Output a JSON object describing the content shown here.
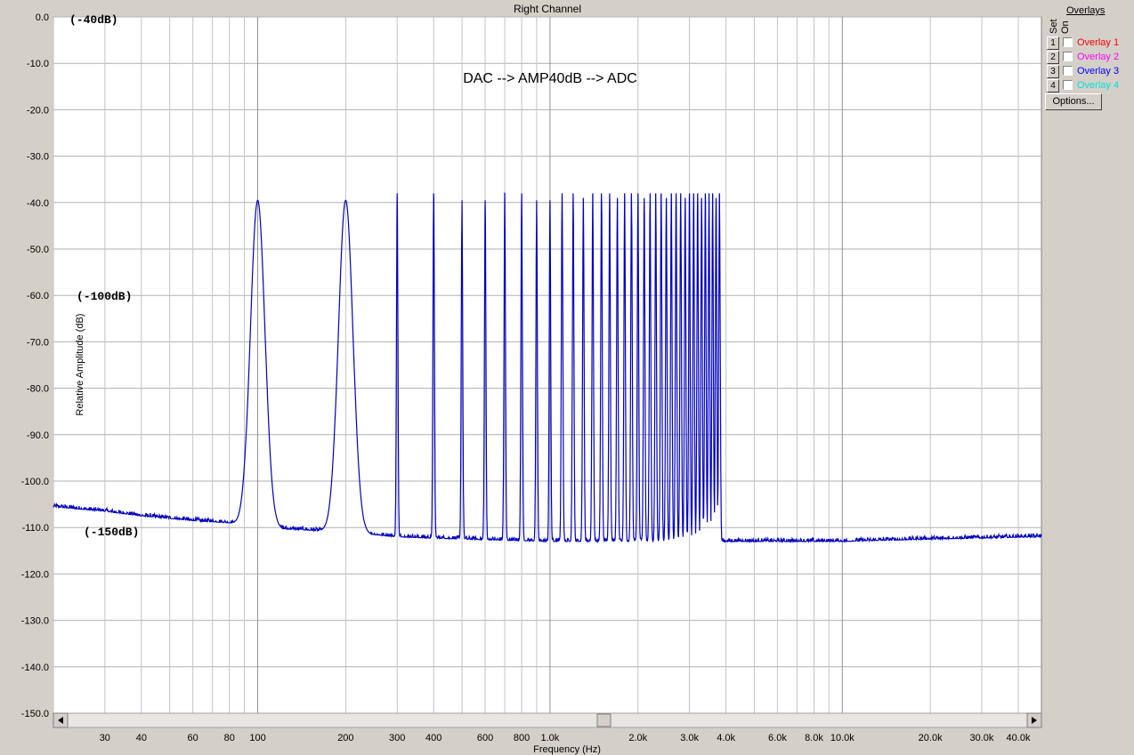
{
  "chart_data": {
    "type": "line",
    "title": "Right Channel",
    "xlabel": "Frequency (Hz)",
    "ylabel": "Relative Amplitude (dB)",
    "x_scale": "log",
    "xlim": [
      20,
      48000
    ],
    "ylim": [
      -150,
      0
    ],
    "yticks": [
      "0.0",
      "-10.0",
      "-20.0",
      "-30.0",
      "-40.0",
      "-50.0",
      "-60.0",
      "-70.0",
      "-80.0",
      "-90.0",
      "-100.0",
      "-110.0",
      "-120.0",
      "-130.0",
      "-140.0",
      "-150.0"
    ],
    "ytick_values": [
      0,
      -10,
      -20,
      -30,
      -40,
      -50,
      -60,
      -70,
      -80,
      -90,
      -100,
      -110,
      -120,
      -130,
      -140,
      -150
    ],
    "xticks": [
      "30",
      "40",
      "60",
      "80",
      "100",
      "200",
      "300",
      "400",
      "600",
      "800",
      "1.0k",
      "2.0k",
      "3.0k",
      "4.0k",
      "6.0k",
      "8.0k",
      "10.0k",
      "20.0k",
      "30.0k",
      "40.0k"
    ],
    "xtick_values": [
      30,
      40,
      60,
      80,
      100,
      200,
      300,
      400,
      600,
      800,
      1000,
      2000,
      3000,
      4000,
      6000,
      8000,
      10000,
      20000,
      30000,
      40000
    ],
    "annotation": "DAC --> AMP40dB --> ADC",
    "right_axis_labels": [
      "(-40dB)",
      "(-100dB)",
      "(-150dB)"
    ],
    "right_axis_values": [
      0,
      -60,
      -110
    ],
    "grid": true,
    "series": [
      {
        "color": "#0000c0",
        "noise_floor": [
          [
            20,
            -105.5
          ],
          [
            30,
            -106.5
          ],
          [
            40,
            -107.5
          ],
          [
            60,
            -108.5
          ],
          [
            80,
            -109
          ],
          [
            100,
            -110
          ],
          [
            200,
            -111
          ],
          [
            300,
            -112
          ],
          [
            500,
            -112.5
          ],
          [
            1000,
            -113
          ],
          [
            4000,
            -113
          ],
          [
            6000,
            -113
          ],
          [
            10000,
            -113
          ],
          [
            20000,
            -112.5
          ],
          [
            48000,
            -112
          ]
        ],
        "peaks": [
          {
            "freq": 100,
            "level": -39.5
          },
          {
            "freq": 200,
            "level": -39.5
          },
          {
            "freq": 300,
            "level": -38
          },
          {
            "freq": 400,
            "level": -38
          },
          {
            "freq": 500,
            "level": -39.5
          },
          {
            "freq": 600,
            "level": -39.5
          },
          {
            "freq": 700,
            "level": -38
          },
          {
            "freq": 800,
            "level": -38
          },
          {
            "freq": 900,
            "level": -39.5
          },
          {
            "freq": 1000,
            "level": -39.5
          },
          {
            "freq": 1100,
            "level": -38
          },
          {
            "freq": 1200,
            "level": -38
          },
          {
            "freq": 1300,
            "level": -39
          },
          {
            "freq": 1400,
            "level": -38
          },
          {
            "freq": 1500,
            "level": -38
          },
          {
            "freq": 1600,
            "level": -38
          },
          {
            "freq": 1700,
            "level": -39
          },
          {
            "freq": 1800,
            "level": -38
          },
          {
            "freq": 1900,
            "level": -38
          },
          {
            "freq": 2000,
            "level": -38
          },
          {
            "freq": 2100,
            "level": -39
          },
          {
            "freq": 2200,
            "level": -38
          },
          {
            "freq": 2300,
            "level": -38
          },
          {
            "freq": 2400,
            "level": -38
          },
          {
            "freq": 2500,
            "level": -39
          },
          {
            "freq": 2600,
            "level": -38
          },
          {
            "freq": 2700,
            "level": -38
          },
          {
            "freq": 2800,
            "level": -38
          },
          {
            "freq": 2900,
            "level": -39
          },
          {
            "freq": 3000,
            "level": -38
          },
          {
            "freq": 3100,
            "level": -38
          },
          {
            "freq": 3200,
            "level": -38
          },
          {
            "freq": 3300,
            "level": -39
          },
          {
            "freq": 3400,
            "level": -38
          },
          {
            "freq": 3500,
            "level": -38
          },
          {
            "freq": 3600,
            "level": -38
          },
          {
            "freq": 3700,
            "level": -39
          },
          {
            "freq": 3800,
            "level": -38
          }
        ]
      }
    ]
  },
  "panel": {
    "title": "Overlays",
    "set_label": "Set",
    "on_label": "On",
    "overlays": [
      {
        "num": "1",
        "label": "Overlay 1",
        "color": "#ff0000"
      },
      {
        "num": "2",
        "label": "Overlay 2",
        "color": "#ff00ff"
      },
      {
        "num": "3",
        "label": "Overlay 3",
        "color": "#0000ff"
      },
      {
        "num": "4",
        "label": "Overlay 4",
        "color": "#00ffff"
      }
    ],
    "options_label": "Options..."
  }
}
